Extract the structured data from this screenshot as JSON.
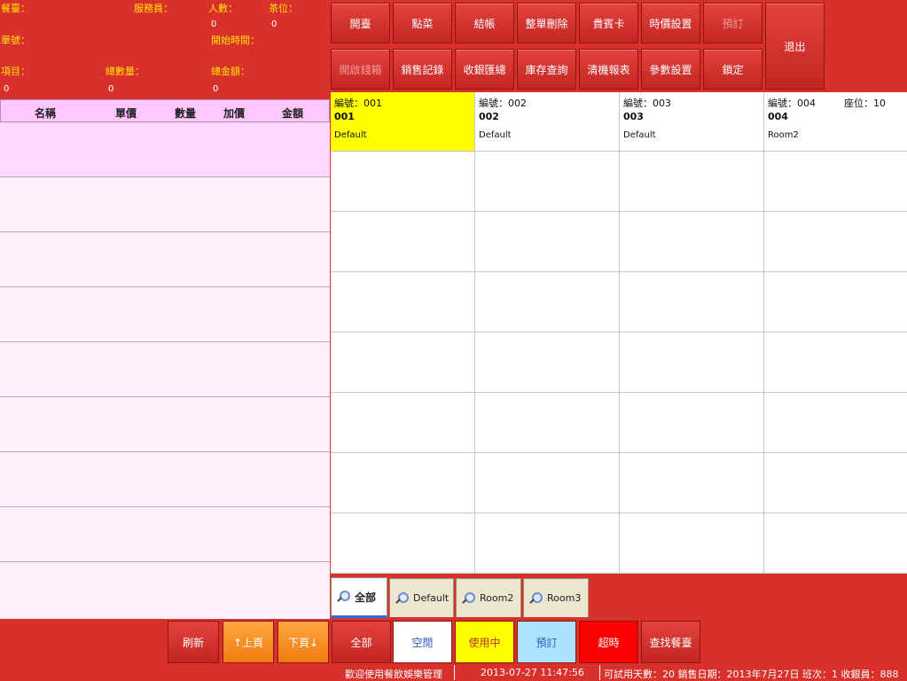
{
  "info": {
    "room_label": "餐臺：",
    "waiter_label": "服務員：",
    "people_label": "人數：",
    "people_value": "0",
    "tea_label": "茶位：",
    "tea_value": "0",
    "order_label": "單號：",
    "start_label": "開始時間：",
    "items_label": "項目：",
    "items_value": "0",
    "qty_label": "總數量：",
    "qty_value": "0",
    "total_label": "總金額：",
    "total_value": "0"
  },
  "order_list": {
    "headers": [
      "名稱",
      "單價",
      "數量",
      "加價",
      "金額"
    ]
  },
  "toolbar": {
    "row1": [
      "開臺",
      "點菜",
      "結帳",
      "整單刪除",
      "貴賓卡",
      "時價設置",
      "預訂"
    ],
    "row2": [
      "開啟錢箱",
      "銷售記錄",
      "收銀匯總",
      "庫存查詢",
      "清機報表",
      "參數設置",
      "鎖定"
    ],
    "exit": "退出"
  },
  "tables": [
    {
      "no_label": "編號：",
      "no": "001",
      "code": "001",
      "area": "Default"
    },
    {
      "no_label": "編號：",
      "no": "002",
      "code": "002",
      "area": "Default"
    },
    {
      "no_label": "編號：",
      "no": "003",
      "code": "003",
      "area": "Default"
    },
    {
      "no_label": "編號：",
      "no": "004",
      "code": "004",
      "area": "Room2",
      "seat_label": "座位：",
      "seat": "10"
    }
  ],
  "tabs": [
    "全部",
    "Default",
    "Room2",
    "Room3"
  ],
  "bottom": {
    "refresh": "刷新",
    "prev": "↑上頁",
    "next": "下頁↓",
    "filter_all": "全部",
    "filter_free": "空閒",
    "filter_inuse": "使用中",
    "filter_reserved": "預訂",
    "filter_overtime": "超時",
    "find_table": "查找餐臺"
  },
  "colors": {
    "free": "#ffffff",
    "inuse": "#ffff00",
    "reserved": "#aee3ff",
    "overtime": "#ff0000"
  },
  "status": {
    "welcome": "歡迎使用餐飲娛樂管理",
    "datetime": "2013-07-27 11:47:56",
    "trial": "可試用天數：20 銷售日期：2013年7月27日 班次：1 收銀員：888"
  }
}
